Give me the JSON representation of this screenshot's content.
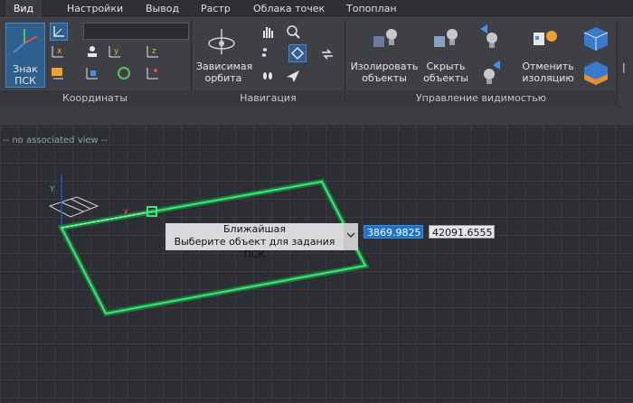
{
  "tabs": [
    {
      "label": "Вид",
      "active": true
    },
    {
      "label": "Настройки",
      "active": false
    },
    {
      "label": "Вывод",
      "active": false
    },
    {
      "label": "Растр",
      "active": false
    },
    {
      "label": "Облака точек",
      "active": false
    },
    {
      "label": "Топоплан",
      "active": false
    }
  ],
  "ribbon": {
    "coords": {
      "label": "Координаты",
      "ucs_button": "Знак\nПСК"
    },
    "nav": {
      "label": "Навигация",
      "orbit": "Зависимая\nорбита"
    },
    "visibility": {
      "label": "Управление видимостью",
      "isolate": "Изолировать\nобъекты",
      "hide": "Скрыть\nобъекты",
      "cancel": "Отменить\nизоляцию"
    }
  },
  "viewport": {
    "no_view": "-- no associated view --",
    "tooltip_title": "Ближайшая",
    "tooltip_text": "Выберите объект для задания ПСК",
    "coord_x": "3869.9825",
    "coord_y": "42091.6555"
  },
  "colors": {
    "accent": "#1e72c8",
    "outline": "#39d36b"
  }
}
